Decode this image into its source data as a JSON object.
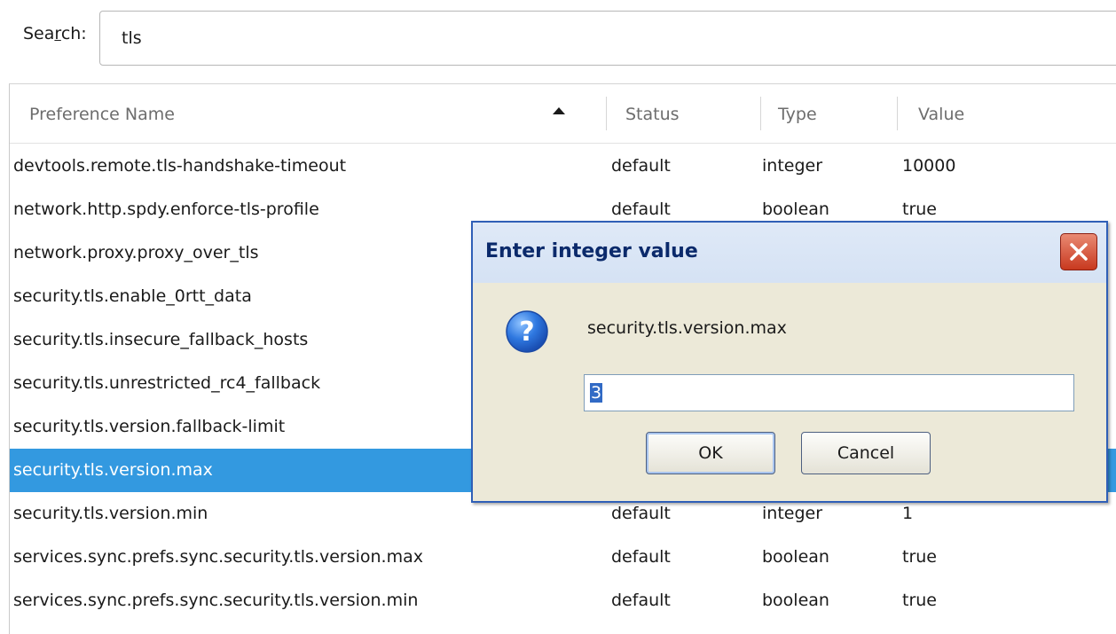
{
  "search": {
    "label_pre": "Sea",
    "label_accel": "r",
    "label_post": "ch:",
    "value": "tls"
  },
  "columns": {
    "name": "Preference Name",
    "status": "Status",
    "type": "Type",
    "value": "Value"
  },
  "rows": [
    {
      "name": "devtools.remote.tls-handshake-timeout",
      "status": "default",
      "type": "integer",
      "value": "10000"
    },
    {
      "name": "network.http.spdy.enforce-tls-profile",
      "status": "default",
      "type": "boolean",
      "value": "true"
    },
    {
      "name": "network.proxy.proxy_over_tls",
      "status": "",
      "type": "",
      "value": ""
    },
    {
      "name": "security.tls.enable_0rtt_data",
      "status": "",
      "type": "",
      "value": ""
    },
    {
      "name": "security.tls.insecure_fallback_hosts",
      "status": "",
      "type": "",
      "value": ""
    },
    {
      "name": "security.tls.unrestricted_rc4_fallback",
      "status": "",
      "type": "",
      "value": ""
    },
    {
      "name": "security.tls.version.fallback-limit",
      "status": "",
      "type": "",
      "value": ""
    },
    {
      "name": "security.tls.version.max",
      "status": "",
      "type": "",
      "value": ""
    },
    {
      "name": "security.tls.version.min",
      "status": "default",
      "type": "integer",
      "value": "1"
    },
    {
      "name": "services.sync.prefs.sync.security.tls.version.max",
      "status": "default",
      "type": "boolean",
      "value": "true"
    },
    {
      "name": "services.sync.prefs.sync.security.tls.version.min",
      "status": "default",
      "type": "boolean",
      "value": "true"
    }
  ],
  "selected_row_index": 7,
  "dialog": {
    "title": "Enter integer value",
    "pref_name": "security.tls.version.max",
    "input_value": "3",
    "ok_label": "OK",
    "cancel_label": "Cancel",
    "icon": "question-icon",
    "close_icon": "close-icon"
  },
  "colors": {
    "selection": "#3399e0",
    "dialog_border": "#2f5fb7",
    "dialog_bg": "#ece9d8",
    "close_button": "#c8391f"
  }
}
